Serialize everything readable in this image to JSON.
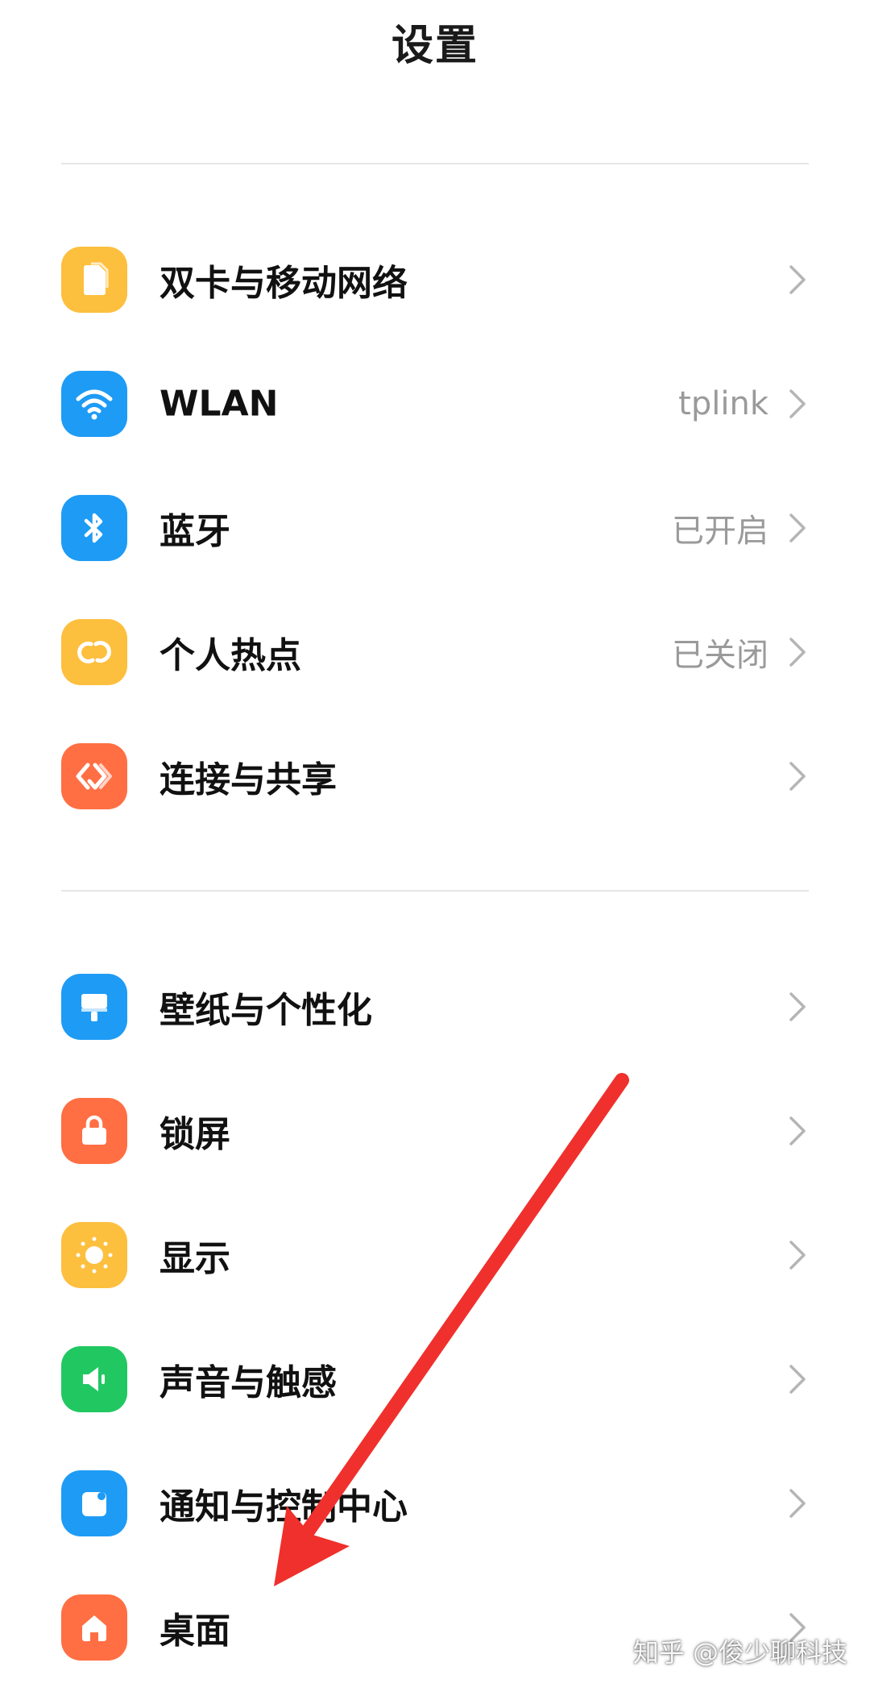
{
  "header": {
    "title": "设置"
  },
  "colors": {
    "yellow": "#FDBF3E",
    "blue": "#1E9BF5",
    "orange": "#FF6F43",
    "green": "#21C862",
    "arrow": "#F0302C"
  },
  "group1": [
    {
      "label": "双卡与移动网络",
      "value": "",
      "icon": "sim-card-icon",
      "color": "#FDBF3E"
    },
    {
      "label": "WLAN",
      "value": "tplink",
      "icon": "wifi-icon",
      "color": "#1E9BF5"
    },
    {
      "label": "蓝牙",
      "value": "已开启",
      "icon": "bluetooth-icon",
      "color": "#1E9BF5"
    },
    {
      "label": "个人热点",
      "value": "已关闭",
      "icon": "hotspot-icon",
      "color": "#FDBF3E"
    },
    {
      "label": "连接与共享",
      "value": "",
      "icon": "connection-share-icon",
      "color": "#FF6F43"
    }
  ],
  "group2": [
    {
      "label": "壁纸与个性化",
      "value": "",
      "icon": "wallpaper-brush-icon",
      "color": "#1E9BF5"
    },
    {
      "label": "锁屏",
      "value": "",
      "icon": "lock-icon",
      "color": "#FF6F43"
    },
    {
      "label": "显示",
      "value": "",
      "icon": "sun-icon",
      "color": "#FDBF3E"
    },
    {
      "label": "声音与触感",
      "value": "",
      "icon": "speaker-icon",
      "color": "#21C862"
    },
    {
      "label": "通知与控制中心",
      "value": "",
      "icon": "notification-icon",
      "color": "#1E9BF5"
    },
    {
      "label": "桌面",
      "value": "",
      "icon": "home-icon",
      "color": "#FF6F43"
    }
  ],
  "watermark": "知乎 @俊少聊科技"
}
